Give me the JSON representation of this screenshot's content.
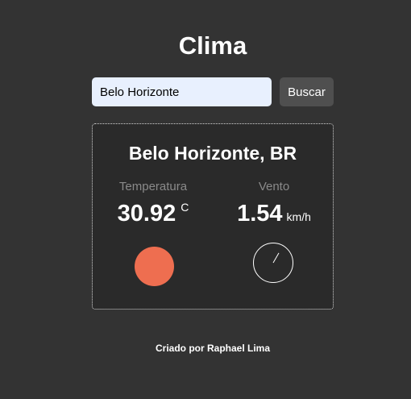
{
  "app": {
    "title": "Clima"
  },
  "search": {
    "value": "Belo Horizonte",
    "button_label": "Buscar"
  },
  "weather": {
    "city": "Belo Horizonte, BR",
    "temperature": {
      "label": "Temperatura",
      "value": "30.92",
      "unit": "C",
      "indicator_color": "#ee6e50",
      "indicator_icon": "temperature-circle-icon"
    },
    "wind": {
      "label": "Vento",
      "value": "1.54",
      "unit": "km/h",
      "direction_degrees": 30,
      "direction_icon": "wind-compass-icon"
    }
  },
  "footer": {
    "text": "Criado por Raphael Lima"
  },
  "colors": {
    "background": "#333333",
    "card_background": "#2a2a2a",
    "input_background": "#e8f0fe",
    "button_background": "#4f4f4f",
    "label_muted": "#8a8a8a"
  }
}
